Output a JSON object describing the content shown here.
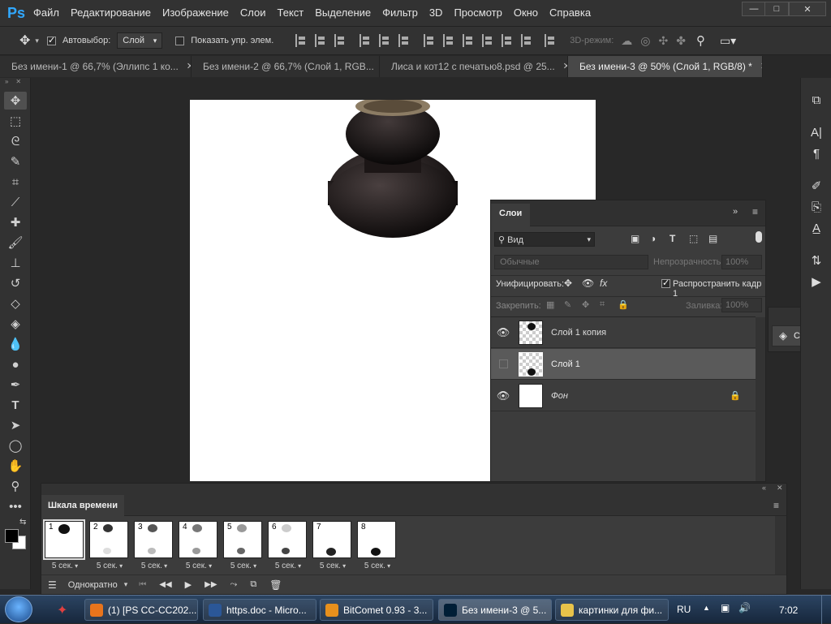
{
  "app": {
    "logo": "Ps"
  },
  "menu": [
    "Файл",
    "Редактирование",
    "Изображение",
    "Слои",
    "Текст",
    "Выделение",
    "Фильтр",
    "3D",
    "Просмотр",
    "Окно",
    "Справка"
  ],
  "window_controls": {
    "minimize": "—",
    "maximize": "□",
    "close": "✕"
  },
  "options": {
    "autoselect_label": "Автовыбор:",
    "autoselect_value": "Слой",
    "show_controls_label": "Показать упр. элем.",
    "mode3d_label": "3D-режим:"
  },
  "tabs": [
    {
      "label": "Без имени-1 @ 66,7% (Эллипс 1 ко...",
      "close": "✕"
    },
    {
      "label": "Без имени-2 @ 66,7% (Слой 1, RGB...",
      "close": "✕"
    },
    {
      "label": "Лиса и кот12 с печатью8.psd @ 25...",
      "close": "✕"
    },
    {
      "label": "Без имени-3 @ 50% (Слой 1, RGB/8) *",
      "close": "✕"
    }
  ],
  "layers_panel": {
    "title": "Слои",
    "filter_label": "Вид",
    "blend_mode": "Обычные",
    "opacity_label": "Непрозрачность:",
    "opacity_value": "100%",
    "unify_label": "Унифицировать:",
    "propagate_label": "Распространить кадр 1",
    "lock_label": "Закрепить:",
    "fill_label": "Заливка:",
    "fill_value": "100%",
    "layers": [
      {
        "name": "Слой 1 копия",
        "visible": true,
        "selected": false
      },
      {
        "name": "Слой 1",
        "visible": false,
        "selected": true
      },
      {
        "name": "Фон",
        "visible": true,
        "selected": false,
        "locked": true
      }
    ]
  },
  "collapsed_panel": {
    "label": "Слои"
  },
  "timeline": {
    "title": "Шкала времени",
    "loop_value": "Однократно",
    "frames": [
      {
        "num": "1",
        "delay": "5 сек."
      },
      {
        "num": "2",
        "delay": "5 сек."
      },
      {
        "num": "3",
        "delay": "5 сек."
      },
      {
        "num": "4",
        "delay": "5 сек."
      },
      {
        "num": "5",
        "delay": "5 сек."
      },
      {
        "num": "6",
        "delay": "5 сек."
      },
      {
        "num": "7",
        "delay": "5 сек."
      },
      {
        "num": "8",
        "delay": "5 сек."
      }
    ]
  },
  "taskbar": {
    "tasks": [
      {
        "label": "(1) [PS CC-CC202...",
        "color": "#e8741c"
      },
      {
        "label": "https.doc - Micro...",
        "color": "#2b5797"
      },
      {
        "label": "BitComet 0.93 - 3...",
        "color": "#e8901c"
      },
      {
        "label": "Без имени-3 @ 5...",
        "color": "#001e36"
      },
      {
        "label": "картинки для фи...",
        "color": "#e8c34a"
      }
    ],
    "lang": "RU",
    "time": "7:02"
  }
}
